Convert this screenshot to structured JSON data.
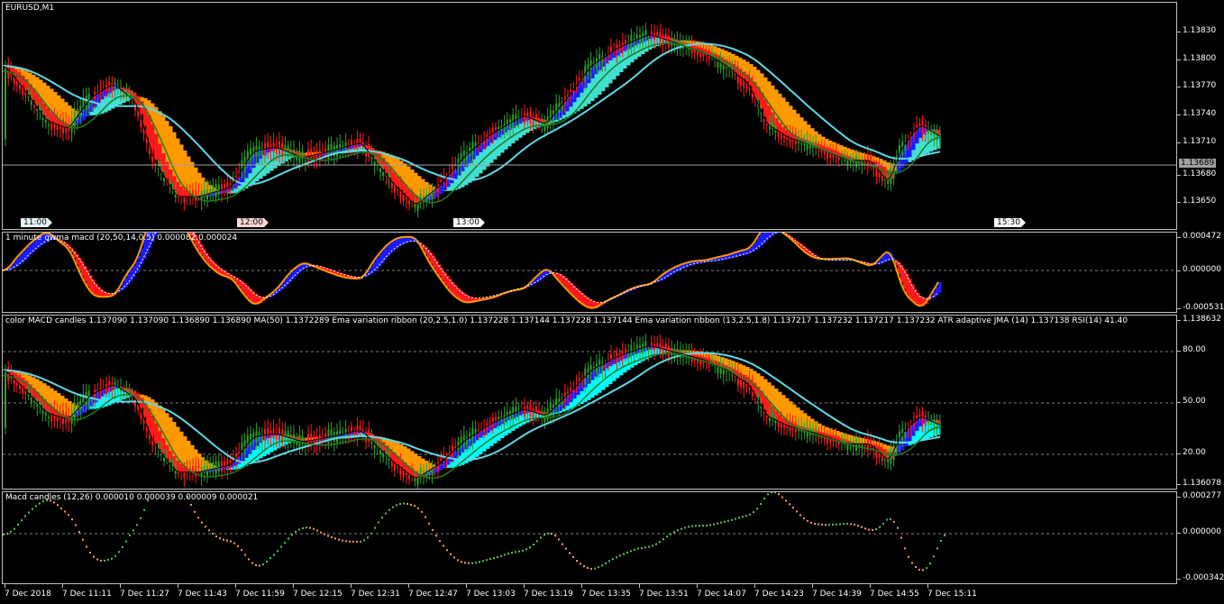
{
  "colors": {
    "background": "#000000",
    "border": "#c0c0c0",
    "bull": "#2ca02c",
    "bear": "#ff1a1a",
    "orange": "#ff9900",
    "blue": "#1a1aff",
    "cyan": "#40e0d0",
    "dotted_up": "#5cc25c",
    "dotted_down": "#ff9966"
  },
  "panes": {
    "main": {
      "label": "EURUSD,M1",
      "price_axis": [
        "1.13830",
        "1.13800",
        "1.13770",
        "1.13740",
        "1.13710",
        "1.13680",
        "1.13650"
      ],
      "current_price": "1.13689",
      "time_markers": [
        {
          "label": "11:00",
          "bg": "#e8f8ff"
        },
        {
          "label": "12:00",
          "bg": "#ffd6d6"
        },
        {
          "label": "13:00",
          "bg": "#ffffff"
        },
        {
          "label": "15:30",
          "bg": "#ffffff"
        }
      ]
    },
    "macd": {
      "label": "1 minute qwma macd (20,50,14,0.5) 0.000082 0.000024",
      "axis": [
        "0.000472",
        "0.000000",
        "-0.000531"
      ]
    },
    "candles": {
      "label": "color MACD candles 1.137090 1.137090 1.136890 1.136890 MA(50) 1.1372289 Ema variation ribbon (20,2.5,1.0) 1.137228 1.137144 1.137228 1.137144 Ema variation ribbon (13,2.5,1.8) 1.137217 1.137232 1.137217 1.137232 ATR adaptive JMA (14) 1.137138 RSI(14) 41.40",
      "axis": [
        "1.138632",
        "80.00",
        "50.00",
        "20.00",
        "1.136078"
      ]
    },
    "macdc": {
      "label": "Macd candles (12,26) 0.000010 0.000039 0.000009 0.000021",
      "axis": [
        "0.000277",
        "0.000000",
        "-0.000342"
      ]
    }
  },
  "time_axis": [
    "7 Dec 2018",
    "7 Dec 11:11",
    "7 Dec 11:27",
    "7 Dec 11:43",
    "7 Dec 11:59",
    "7 Dec 12:15",
    "7 Dec 12:31",
    "7 Dec 12:47",
    "7 Dec 13:03",
    "7 Dec 13:19",
    "7 Dec 13:35",
    "7 Dec 13:51",
    "7 Dec 14:07",
    "7 Dec 14:23",
    "7 Dec 14:39",
    "7 Dec 14:55",
    "7 Dec 15:11"
  ]
}
